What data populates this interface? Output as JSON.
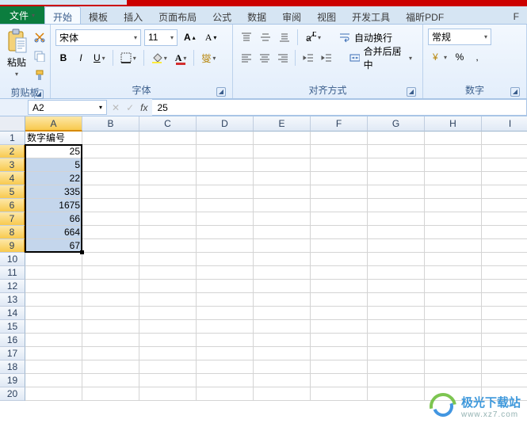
{
  "menu": {
    "file": "文件",
    "tabs": [
      "开始",
      "模板",
      "插入",
      "页面布局",
      "公式",
      "数据",
      "审阅",
      "视图",
      "开发工具",
      "福昕PDF"
    ],
    "active": 0,
    "overflow": "F"
  },
  "ribbon": {
    "clipboard": {
      "paste": "粘贴",
      "label": "剪贴板"
    },
    "font": {
      "name": "宋体",
      "size": "11",
      "label": "字体",
      "bold": "B",
      "italic": "I",
      "underline": "U",
      "wen": "燮"
    },
    "align": {
      "label": "对齐方式",
      "wrap": "自动换行",
      "merge": "合并后居中"
    },
    "number": {
      "label": "数字",
      "format": "常规",
      "percent": "%",
      "comma": ","
    }
  },
  "formulabar": {
    "name": "A2",
    "fx": "fx",
    "value": "25"
  },
  "grid": {
    "columns": [
      "A",
      "B",
      "C",
      "D",
      "E",
      "F",
      "G",
      "H",
      "I"
    ],
    "selcol": 0,
    "selrows": [
      2,
      3,
      4,
      5,
      6,
      7,
      8,
      9
    ],
    "rowcount": 20,
    "header_cell": "数字编号",
    "data": [
      "25",
      "5",
      "22",
      "335",
      "1675",
      "66",
      "664",
      "67"
    ]
  },
  "watermark": {
    "name": "极光下载站",
    "url": "www.xz7.com"
  },
  "chart_data": {
    "type": "table",
    "title": "数字编号",
    "categories": [
      "Row2",
      "Row3",
      "Row4",
      "Row5",
      "Row6",
      "Row7",
      "Row8",
      "Row9"
    ],
    "values": [
      25,
      5,
      22,
      335,
      1675,
      66,
      664,
      67
    ]
  }
}
